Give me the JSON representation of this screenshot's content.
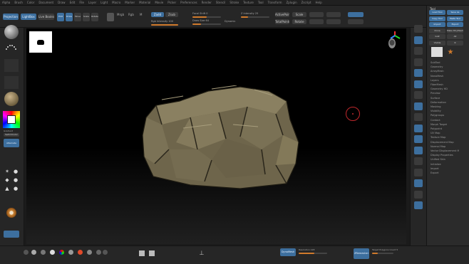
{
  "menu": {
    "items": [
      "Alpha",
      "Brush",
      "Color",
      "Document",
      "Draw",
      "Edit",
      "File",
      "Layer",
      "Light",
      "Macro",
      "Marker",
      "Material",
      "Movie",
      "Picker",
      "Preferences",
      "Render",
      "Stencil",
      "Stroke",
      "Texture",
      "Tool",
      "Transform",
      "Zplugin",
      "Zscript",
      "Help"
    ]
  },
  "toolbar": {
    "projection_label": "Projection",
    "lightbox_label": "LightBox",
    "live_boolean_label": "Live Boolean",
    "edit_label": "Edit",
    "draw_label": "Draw",
    "move_label": "Move",
    "scale_label": "Scale",
    "rotate_label": "Rotate",
    "mrgb_label": "Mrgb",
    "rgb_label": "Rgb",
    "m_label": "M",
    "zadd_label": "Zadd",
    "zsub_label": "Zsub",
    "focal_label": "Focal Shift 0",
    "draw_size_label": "Draw Size 64",
    "dynamic_label": "Dynamic",
    "z_intensity_label": "Z Intensity 25",
    "rgb_intensity_label": "Rgb Intensity 100",
    "active_points_label": "ActivePoints: 9,872",
    "total_points_label": "TotalPoints: 9,872",
    "scale_readout": "Scale",
    "rotate_readout": "Rotate"
  },
  "left_panel": {
    "gradient_label": "Gradient",
    "switch_label": "SwitchColor",
    "alternate_label": "Alternate"
  },
  "tray": {
    "header": "Tool",
    "buttons": [
      "Load Tool",
      "Save As",
      "Copy Tool",
      "Paste Tool",
      "Import",
      "Export",
      "Clone",
      "Make PolyMesh3D",
      "GoZ",
      "All",
      "Visible",
      "R"
    ],
    "subtools": [
      "SubTool",
      "Geometry",
      "ArrayMesh",
      "NanoMesh",
      "Layers",
      "FiberMesh",
      "Geometry HD",
      "Preview",
      "Surface",
      "Deformation",
      "Masking",
      "Visibility",
      "Polygroups",
      "Contact",
      "Morph Target",
      "Polypaint",
      "UV Map",
      "Texture Map",
      "Displacement Map",
      "Normal Map",
      "Vector Displacement Map",
      "Display Properties",
      "Unified Skin",
      "Initialize",
      "Import",
      "Export"
    ]
  },
  "bottom": {
    "dynamesh_label": "DynaMesh",
    "resolution_label": "Resolution 128",
    "zremesher_label": "ZRemesher",
    "target_label": "Target Polygons Count 5"
  },
  "colors": {
    "accent": "#3d6f9e",
    "slider_fill": "#d07a2c",
    "rock_base": "#7d7459",
    "cursor_ring": "#c0282c"
  }
}
